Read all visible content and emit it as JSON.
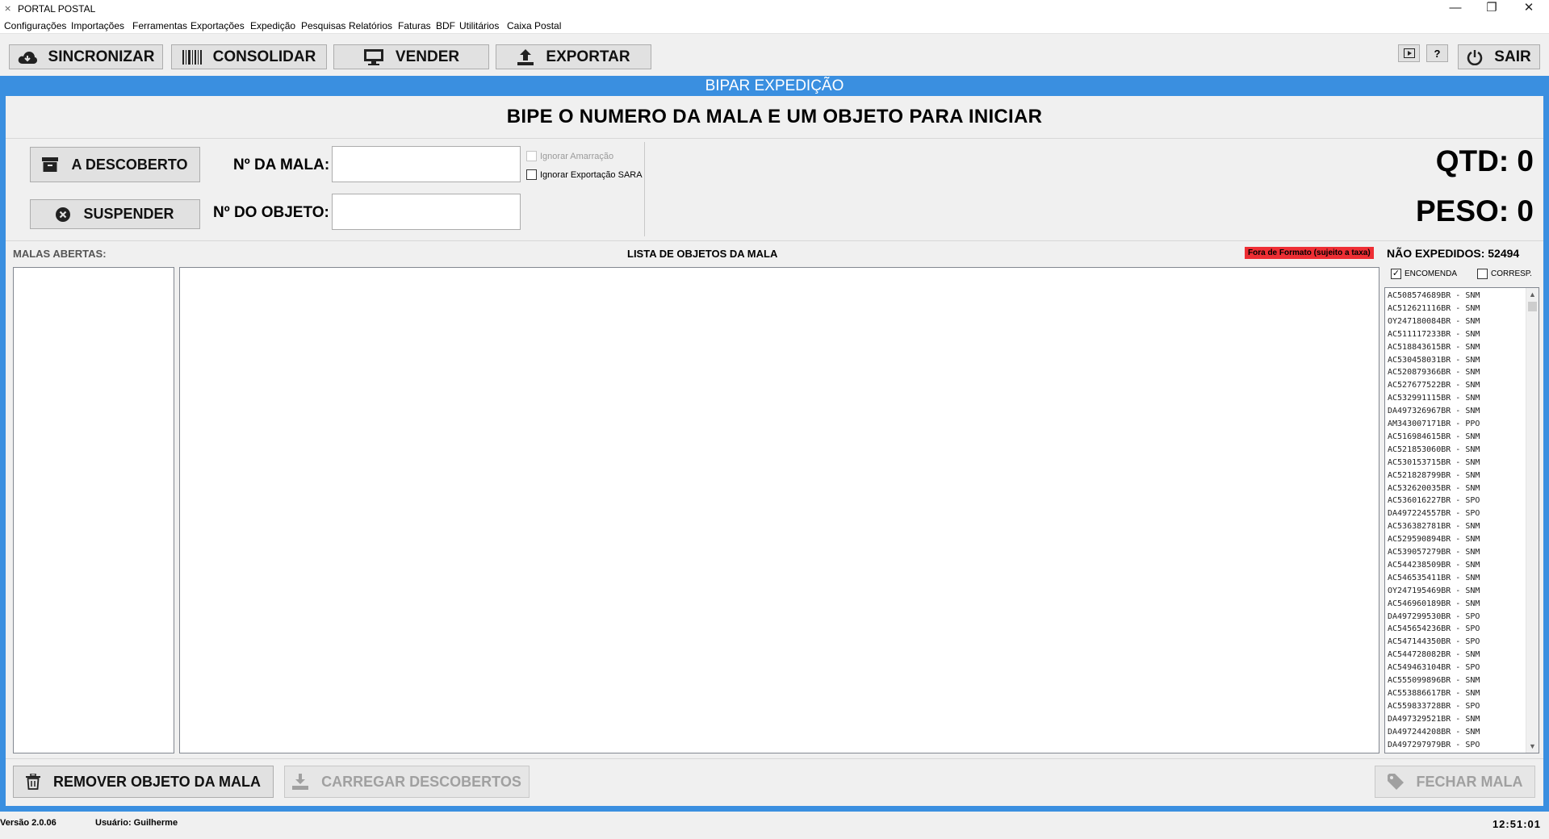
{
  "window": {
    "title": "PORTAL POSTAL",
    "controls": [
      "—",
      "❐",
      "✕"
    ]
  },
  "menu": [
    "Configurações",
    "Importações",
    "Ferramentas",
    "Exportações",
    "Expedição",
    "Pesquisas",
    "Relatórios",
    "Faturas",
    "BDF",
    "Utilitários",
    "Caixa Postal"
  ],
  "toolbar": {
    "sincronizar": "SINCRONIZAR",
    "consolidar": "CONSOLIDAR",
    "vender": "VENDER",
    "exportar": "EXPORTAR",
    "help": "?",
    "sair": "SAIR"
  },
  "panel": {
    "title": "BIPAR EXPEDIÇÃO",
    "headline": "BIPE O NUMERO DA MALA E UM OBJETO PARA INICIAR"
  },
  "form": {
    "a_descoberto": "A DESCOBERTO",
    "suspender": "SUSPENDER",
    "mala_label": "Nº DA MALA:",
    "mala_value": "",
    "objeto_label": "Nº DO OBJETO:",
    "objeto_value": "",
    "ignorar_amarracao": "Ignorar Amarração",
    "ignorar_exportacao": "Ignorar Exportação SARA"
  },
  "totals": {
    "qtd": "QTD: 0",
    "peso": "PESO: 0"
  },
  "sections": {
    "malas_abertas": "MALAS ABERTAS:",
    "lista_objetos": "LISTA DE OBJETOS DA MALA",
    "fora_formato": "Fora de Formato (sujeito a taxa)",
    "nao_expedidos": "NÃO EXPEDIDOS: 52494",
    "encomenda": "ENCOMENDA",
    "encomenda_checked": true,
    "corresp": "CORRESP.",
    "corresp_checked": false
  },
  "colors": {
    "accent": "#3a8fe0",
    "badge": "#ee2e34"
  },
  "pending": [
    "AC508574689BR - SNM",
    "AC512621116BR - SNM",
    "OY247180084BR - SNM",
    "AC511117233BR - SNM",
    "AC518843615BR - SNM",
    "AC530458031BR - SNM",
    "AC520879366BR - SNM",
    "AC527677522BR - SNM",
    "AC532991115BR - SNM",
    "DA497326967BR - SNM",
    "AM343007171BR - PPO",
    "AC516984615BR - SNM",
    "AC521853060BR - SNM",
    "AC530153715BR - SNM",
    "AC521828799BR - SNM",
    "AC532620035BR - SNM",
    "AC536016227BR - SPO",
    "DA497224557BR - SPO",
    "AC536382781BR - SNM",
    "AC529590894BR - SNM",
    "AC539057279BR - SNM",
    "AC544238509BR - SNM",
    "AC546535411BR - SNM",
    "OY247195469BR - SNM",
    "AC546960189BR - SNM",
    "DA497299530BR - SPO",
    "AC545654236BR - SPO",
    "AC547144350BR - SPO",
    "AC544728082BR - SNM",
    "AC549463104BR - SPO",
    "AC555099896BR - SNM",
    "AC553886617BR - SNM",
    "AC559833728BR - SPO",
    "DA497329521BR - SNM",
    "DA497244208BR - SNM",
    "DA497297979BR - SPO"
  ],
  "bottom": {
    "remover": "REMOVER OBJETO DA MALA",
    "carregar": "CARREGAR DESCOBERTOS",
    "fechar": "FECHAR MALA"
  },
  "status": {
    "versao": "Versão 2.0.06",
    "usuario": "Usuário: Guilherme",
    "clock": "12:51:01"
  }
}
